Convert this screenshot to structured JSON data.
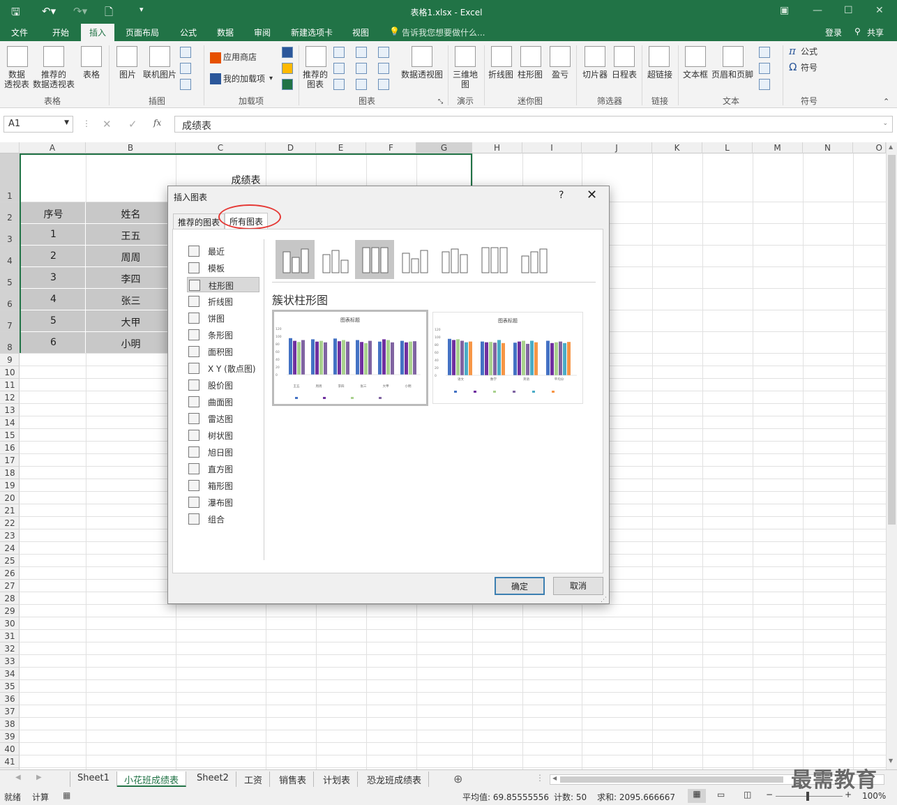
{
  "titlebar": {
    "title": "表格1.xlsx - Excel"
  },
  "menu": {
    "tabs": [
      "文件",
      "开始",
      "插入",
      "页面布局",
      "公式",
      "数据",
      "审阅",
      "新建选项卡",
      "视图"
    ],
    "tellme": "告诉我您想要做什么...",
    "login": "登录",
    "share": "共享"
  },
  "ribbon": {
    "pivot": "数据\n透视表",
    "rec_pivot": "推荐的\n数据透视表",
    "table": "表格",
    "picture": "图片",
    "online_picture": "联机图片",
    "store": "应用商店",
    "my_addins": "我的加载项",
    "rec_charts": "推荐的\n图表",
    "pivot_chart": "数据透视图",
    "map3d": "三维地\n图",
    "line": "折线图",
    "column": "柱形图",
    "winloss": "盈亏",
    "slicer": "切片器",
    "timeline": "日程表",
    "hyperlink": "超链接",
    "textbox": "文本框",
    "headerfooter": "页眉和页脚",
    "equation": "公式",
    "symbol": "符号",
    "groups": {
      "tables": "表格",
      "illustrations": "插图",
      "addins": "加载项",
      "charts": "图表",
      "tours": "演示",
      "sparklines": "迷你图",
      "filters": "筛选器",
      "links": "链接",
      "text": "文本",
      "symbols": "符号"
    }
  },
  "formula": {
    "namebox": "A1",
    "content": "成绩表"
  },
  "columns": [
    "A",
    "B",
    "C",
    "D",
    "E",
    "F",
    "G",
    "H",
    "I",
    "J",
    "K",
    "L",
    "M",
    "N",
    "O"
  ],
  "sheet": {
    "title": "成绩表",
    "headers": [
      "序号",
      "姓名"
    ],
    "rows": [
      [
        "1",
        "王五"
      ],
      [
        "2",
        "周周"
      ],
      [
        "3",
        "李四"
      ],
      [
        "4",
        "张三"
      ],
      [
        "5",
        "大甲"
      ],
      [
        "6",
        "小明"
      ]
    ]
  },
  "dialog": {
    "title": "插入图表",
    "help": "?",
    "close": "✕",
    "tab_recommended": "推荐的图表",
    "tab_all": "所有图表",
    "categories": [
      "最近",
      "模板",
      "柱形图",
      "折线图",
      "饼图",
      "条形图",
      "面积图",
      "X Y (散点图)",
      "股价图",
      "曲面图",
      "雷达图",
      "树状图",
      "旭日图",
      "直方图",
      "箱形图",
      "瀑布图",
      "组合"
    ],
    "selected_category": "柱形图",
    "subtype_title": "簇状柱形图",
    "preview_title": "图表标题",
    "ok": "确定",
    "cancel": "取消"
  },
  "preview1": {
    "yticks": [
      "120",
      "100",
      "80",
      "60",
      "40",
      "20",
      "0"
    ],
    "xlabels": [
      "王五",
      "周周",
      "李四",
      "张三",
      "大甲",
      "小明"
    ],
    "values": [
      [
        95,
        88,
        85,
        90
      ],
      [
        92,
        86,
        88,
        84
      ],
      [
        94,
        87,
        90,
        86
      ],
      [
        90,
        85,
        82,
        88
      ],
      [
        86,
        92,
        90,
        84
      ],
      [
        88,
        84,
        86,
        87
      ]
    ],
    "colors": [
      "#4472c4",
      "#7030a0",
      "#a9d18e",
      "#8064a2"
    ]
  },
  "preview2": {
    "yticks": [
      "120",
      "100",
      "80",
      "60",
      "40",
      "20",
      "0"
    ],
    "xlabels": [
      "语文",
      "数学",
      "英语",
      "平均分"
    ],
    "values": [
      [
        95,
        92,
        94,
        90,
        86,
        88
      ],
      [
        88,
        86,
        87,
        85,
        92,
        84
      ],
      [
        85,
        88,
        90,
        82,
        90,
        86
      ],
      [
        90,
        84,
        86,
        88,
        84,
        87
      ]
    ],
    "colors": [
      "#4472c4",
      "#7030a0",
      "#a9d18e",
      "#8064a2",
      "#4bacc6",
      "#f79646"
    ]
  },
  "sheets": {
    "tabs": [
      "Sheet1",
      "小花班成绩表",
      "Sheet2",
      "工资",
      "销售表",
      "计划表",
      "恐龙班成绩表"
    ],
    "active": "小花班成绩表"
  },
  "status": {
    "ready": "就绪",
    "calc": "计算",
    "average": "平均值: 69.85555556",
    "count": "计数: 50",
    "sum": "求和: 2095.666667",
    "zoom": "100%"
  },
  "watermark": "最需教育"
}
